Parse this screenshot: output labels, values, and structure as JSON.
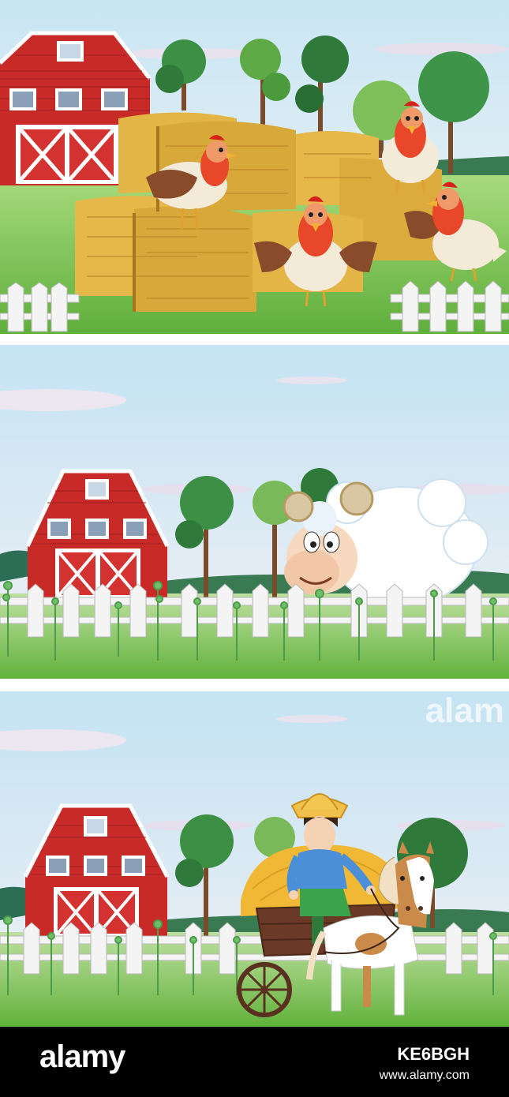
{
  "footer": {
    "logo_text": "alamy",
    "image_id": "KE6BGH",
    "site_url": "www.alamy.com"
  },
  "watermark": "alam",
  "scenes": [
    {
      "subject": "chickens-on-hay-bales"
    },
    {
      "subject": "sheep-behind-fence"
    },
    {
      "subject": "farmer-with-horse-cart"
    }
  ],
  "colors": {
    "sky_top": "#c8e4f2",
    "sky_bottom": "#eef3f6",
    "grass": "#7cc356",
    "barn_red": "#c82a28",
    "hay": "#e6b84a",
    "hen_red": "#e9472a",
    "fence_white": "#f4f4f4",
    "footer_bg": "#000000"
  }
}
